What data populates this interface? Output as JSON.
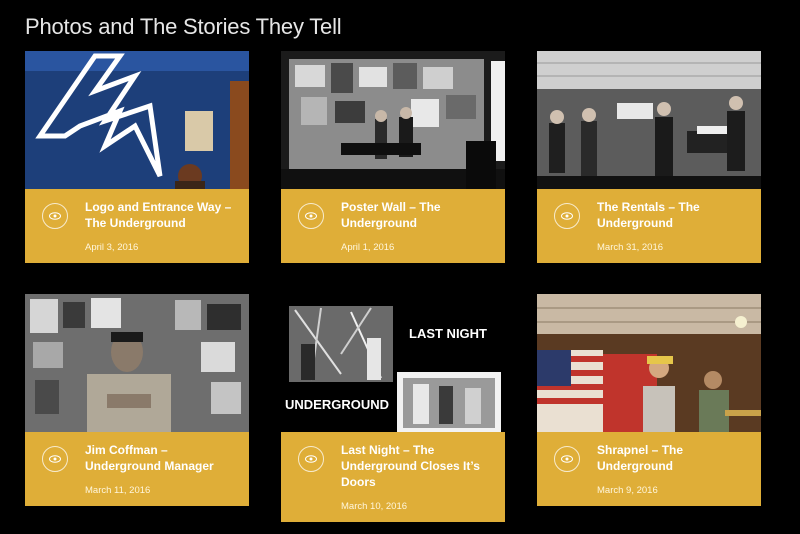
{
  "page": {
    "title": "Photos and The Stories They Tell"
  },
  "posts": [
    {
      "title": "Logo and Entrance Way – The Underground",
      "date": "April 3, 2016",
      "icon": "eye-icon"
    },
    {
      "title": "Poster Wall – The Underground",
      "date": "April 1, 2016",
      "icon": "eye-icon"
    },
    {
      "title": "The Rentals – The Underground",
      "date": "March 31, 2016",
      "icon": "eye-icon"
    },
    {
      "title": "Jim Coffman – Underground Manager",
      "date": "March 11, 2016",
      "icon": "eye-icon"
    },
    {
      "title": "Last Night – The Underground Closes It’s Doors",
      "date": "March 10, 2016",
      "icon": "eye-icon",
      "image_text": {
        "top": "LAST NIGHT",
        "bottom": "UNDERGROUND"
      }
    },
    {
      "title": "Shrapnel – The Underground",
      "date": "March 9, 2016",
      "icon": "eye-icon"
    }
  ],
  "colors": {
    "caption_bg": "#dfae38",
    "page_bg": "#000000",
    "title_text": "#e6e6e6"
  }
}
